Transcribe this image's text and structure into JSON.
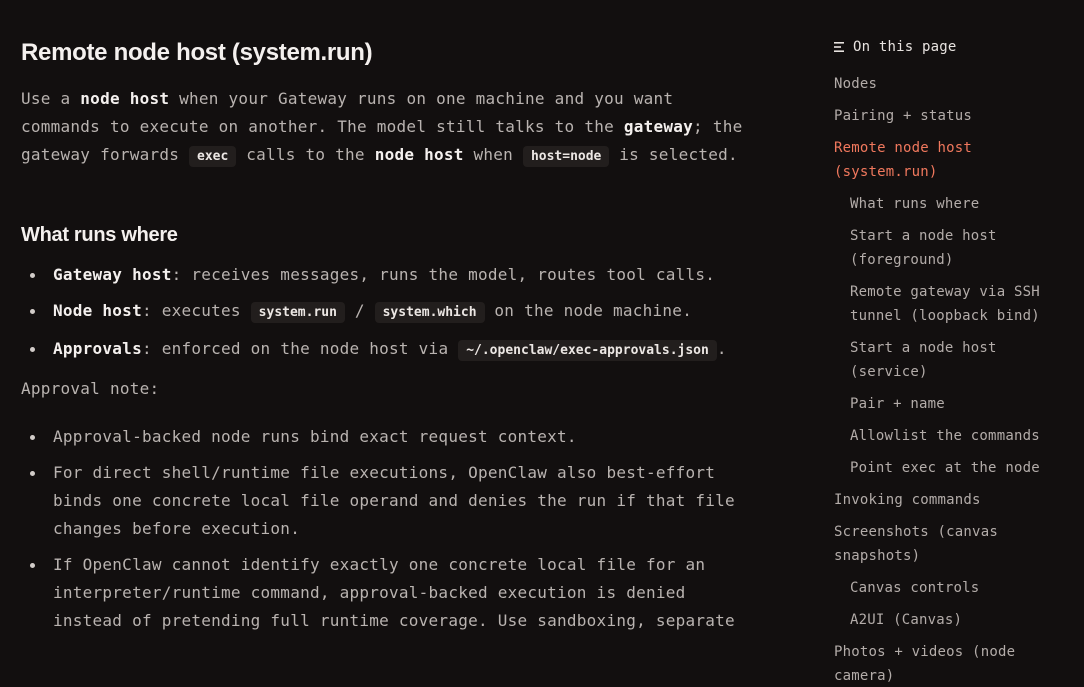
{
  "page": {
    "title": "Remote node host (system.run)",
    "intro": {
      "t1": "Use a ",
      "b1": "node host",
      "t2": " when your Gateway runs on one machine and you want commands to execute on another. The model still talks to the ",
      "b2": "gateway",
      "t3": "; the gateway forwards ",
      "c1": "exec",
      "t4": " calls to the ",
      "b3": "node host",
      "t5": " when ",
      "c2": "host=node",
      "t6": " is selected."
    },
    "section_title": "What runs where",
    "roles": [
      {
        "name": "Gateway host",
        "text": ": receives messages, runs the model, routes tool calls."
      },
      {
        "name": "Node host",
        "text_a": ": executes ",
        "code_a": "system.run",
        "sep": " / ",
        "code_b": "system.which",
        "text_b": " on the node machine."
      },
      {
        "name": "Approvals",
        "text_a": ": enforced on the node host via ",
        "code_a": "~/.openclaw/exec-approvals.json",
        "text_b": "."
      }
    ],
    "approval_note_label": "Approval note:",
    "approval_notes": [
      "Approval-backed node runs bind exact request context.",
      "For direct shell/runtime file executions, OpenClaw also best-effort binds one concrete local file operand and denies the run if that file changes before execution.",
      "If OpenClaw cannot identify exactly one concrete local file for an interpreter/runtime command, approval-backed execution is denied instead of pretending full runtime coverage. Use sandboxing, separate"
    ]
  },
  "toc": {
    "header": "On this page",
    "header_icon": "list-lines-icon",
    "active_color": "#f0785d",
    "items": [
      {
        "label": "Nodes",
        "level": 1,
        "active": false
      },
      {
        "label": "Pairing + status",
        "level": 1,
        "active": false
      },
      {
        "label": "Remote node host (system.run)",
        "level": 1,
        "active": true
      },
      {
        "label": "What runs where",
        "level": 2,
        "active": false
      },
      {
        "label": "Start a node host (foreground)",
        "level": 2,
        "active": false
      },
      {
        "label": "Remote gateway via SSH tunnel (loopback bind)",
        "level": 2,
        "active": false
      },
      {
        "label": "Start a node host (service)",
        "level": 2,
        "active": false
      },
      {
        "label": "Pair + name",
        "level": 2,
        "active": false
      },
      {
        "label": "Allowlist the commands",
        "level": 2,
        "active": false
      },
      {
        "label": "Point exec at the node",
        "level": 2,
        "active": false
      },
      {
        "label": "Invoking commands",
        "level": 1,
        "active": false
      },
      {
        "label": "Screenshots (canvas snapshots)",
        "level": 1,
        "active": false
      },
      {
        "label": "Canvas controls",
        "level": 2,
        "active": false
      },
      {
        "label": "A2UI (Canvas)",
        "level": 2,
        "active": false
      },
      {
        "label": "Photos + videos (node camera)",
        "level": 1,
        "active": false
      }
    ]
  }
}
